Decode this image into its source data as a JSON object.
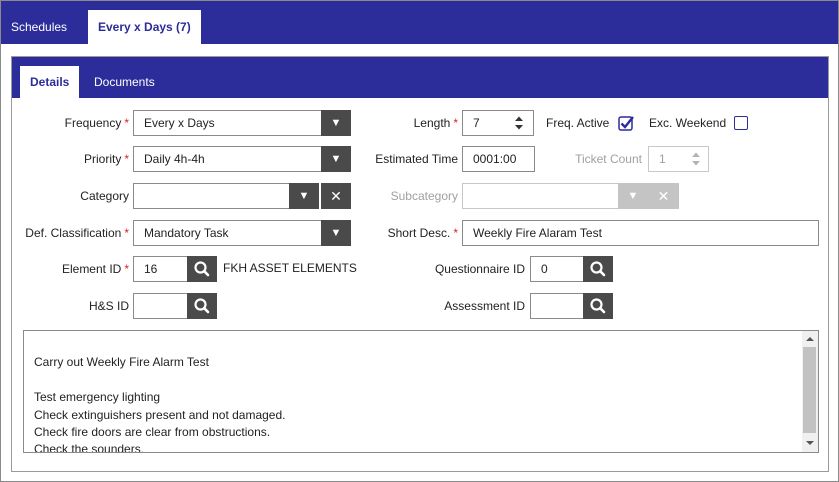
{
  "outer_tabs": [
    "Schedules",
    "Every x Days (7)"
  ],
  "inner_tabs": [
    "Details",
    "Documents"
  ],
  "form": {
    "frequency": {
      "label": "Frequency",
      "value": "Every x Days"
    },
    "priority": {
      "label": "Priority",
      "value": "Daily 4h-4h"
    },
    "category": {
      "label": "Category",
      "value": ""
    },
    "def_classification": {
      "label": "Def. Classification",
      "value": "Mandatory Task"
    },
    "element_id": {
      "label": "Element ID",
      "value": "16",
      "note": "FKH ASSET ELEMENTS"
    },
    "hs_id": {
      "label": "H&S ID",
      "value": ""
    },
    "length": {
      "label": "Length",
      "value": "7"
    },
    "freq_active": {
      "label": "Freq. Active",
      "checked": true
    },
    "exc_weekend": {
      "label": "Exc. Weekend",
      "checked": false
    },
    "estimated_time": {
      "label": "Estimated Time",
      "value": "0001:00"
    },
    "ticket_count": {
      "label": "Ticket Count",
      "value": "1"
    },
    "subcategory": {
      "label": "Subcategory",
      "value": ""
    },
    "short_desc": {
      "label": "Short Desc.",
      "value": "Weekly Fire Alaram Test"
    },
    "questionnaire_id": {
      "label": "Questionnaire ID",
      "value": "0"
    },
    "assessment_id": {
      "label": "Assessment ID",
      "value": ""
    }
  },
  "description": "Carry out Weekly Fire Alarm Test\n\nTest emergency lighting\nCheck extinguishers present and not damaged.\nCheck fire doors are clear from obstructions.\nCheck the sounders.",
  "colors": {
    "brand": "#2c2c9a",
    "required": "#dd2222",
    "button": "#4a4a4a"
  },
  "icons": {
    "dropdown": "caret-down-icon",
    "clear": "close-icon",
    "search": "search-icon",
    "spin": "spinner-arrows-icon",
    "check": "checkmark-icon"
  }
}
